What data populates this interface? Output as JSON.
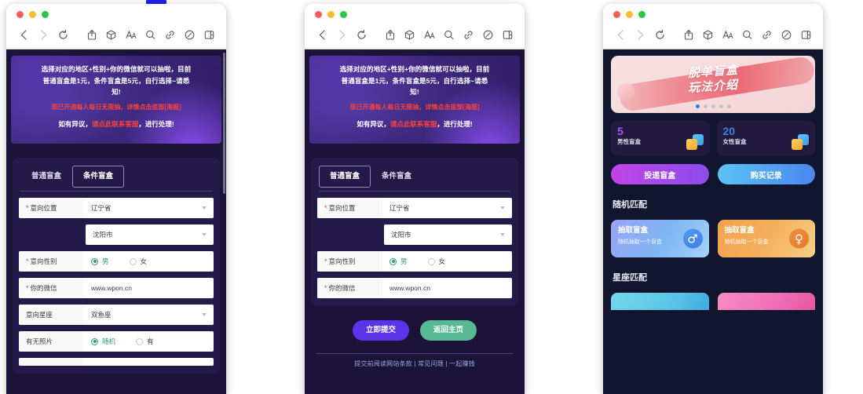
{
  "browser": {
    "traffic_lights": [
      "close",
      "minimize",
      "maximize"
    ],
    "toolbar_icons": [
      "back-chevron-icon",
      "forward-chevron-icon",
      "reload-icon",
      "share-icon",
      "package-icon",
      "text-size-icon",
      "search-icon",
      "link-icon",
      "compass-icon",
      "sidebar-icon"
    ]
  },
  "panel1": {
    "promo": {
      "line1": "选择对应的地区+性别+你的微信就可以抽啦，目前",
      "line2": "普通盲盒是1元，条件盲盒是5元，自行选择~请悉",
      "line3": "知!",
      "red_line": "现已开通每人每日无限抽，详情点击底部[海报]",
      "mix_prefix": "如有异议，",
      "mix_link": "请点此联系客服",
      "mix_suffix": "，进行处理!"
    },
    "tabs": [
      {
        "label": "普通盲盒",
        "selected": false
      },
      {
        "label": "条件盲盒",
        "selected": true
      }
    ],
    "fields": [
      {
        "label": "意向位置",
        "required": true,
        "value": "辽宁省",
        "type": "select"
      },
      {
        "label": "",
        "required": false,
        "value": "沈阳市",
        "type": "select-indent"
      },
      {
        "label": "意向性别",
        "required": true,
        "type": "radio",
        "options": [
          {
            "text": "男",
            "checked": true
          },
          {
            "text": "女",
            "checked": false
          }
        ]
      },
      {
        "label": "你的微信",
        "required": true,
        "value": "www.wpon.cn",
        "type": "text"
      },
      {
        "label": "意向星座",
        "required": false,
        "value": "双鱼座",
        "type": "select"
      },
      {
        "label": "有无照片",
        "required": false,
        "type": "radio",
        "options": [
          {
            "text": "随机",
            "checked": true
          },
          {
            "text": "有",
            "checked": false
          }
        ]
      }
    ]
  },
  "panel2": {
    "promo": {
      "line1": "选择对应的地区+性别+你的微信就可以抽啦，目前",
      "line2": "普通盲盒是1元，条件盲盒是5元，自行选择~请悉",
      "line3": "知!",
      "red_line": "现已开通每人每日无限抽，详情点击底部[海报]",
      "mix_prefix": "如有异议，",
      "mix_link": "请点此联系客服",
      "mix_suffix": "，进行处理!"
    },
    "tabs": [
      {
        "label": "普通盲盒",
        "selected": true
      },
      {
        "label": "条件盲盒",
        "selected": false
      }
    ],
    "fields": [
      {
        "label": "意向位置",
        "required": true,
        "value": "辽宁省",
        "type": "select"
      },
      {
        "label": "",
        "required": false,
        "value": "沈阳市",
        "type": "select-indent"
      },
      {
        "label": "意向性别",
        "required": true,
        "type": "radio",
        "options": [
          {
            "text": "男",
            "checked": true
          },
          {
            "text": "女",
            "checked": false
          }
        ]
      },
      {
        "label": "你的微信",
        "required": true,
        "value": "www.wpon.cn",
        "type": "text"
      }
    ],
    "submit_label": "立即提交",
    "home_label": "返回主页",
    "footer_links": "提交前阅读网站条款 | 常见问题 | 一起赚钱"
  },
  "panel3": {
    "hero": {
      "title_line1": "脱单盲盒",
      "title_line2": "玩法介绍",
      "dot_count": 5,
      "active_dot": 0
    },
    "stats": [
      {
        "number": "5",
        "label": "男性盲盒",
        "color": "#a259f0"
      },
      {
        "number": "20",
        "label": "女性盲盒",
        "color": "#3f7fe8"
      }
    ],
    "cta": [
      {
        "label": "投递盲盒"
      },
      {
        "label": "购买记录"
      }
    ],
    "section_random": "随机匹配",
    "section_zodiac": "星座匹配",
    "draw_cards": [
      {
        "title": "抽取盲盒",
        "subtitle": "随机抽取一个盲盒",
        "icon": "♂",
        "theme": "blue"
      },
      {
        "title": "抽取盲盒",
        "subtitle": "随机抽取一个盲盒",
        "icon": "♀",
        "theme": "orange"
      }
    ]
  }
}
